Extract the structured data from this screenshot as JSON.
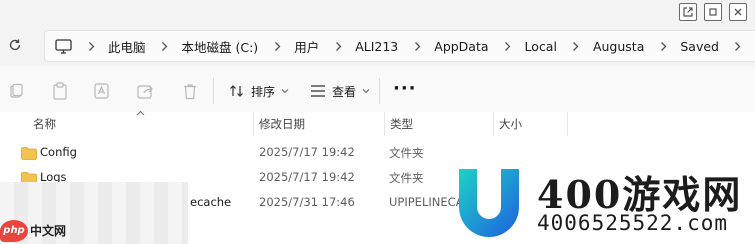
{
  "address": {
    "breadcrumbs": [
      "此电脑",
      "本地磁盘 (C:)",
      "用户",
      "ALI213",
      "AppData",
      "Local",
      "Augusta",
      "Saved"
    ]
  },
  "toolbar": {
    "sort_label": "排序",
    "view_label": "查看",
    "more_label": "···"
  },
  "columns": {
    "name": "名称",
    "modified": "修改日期",
    "type": "类型",
    "size": "大小"
  },
  "files": [
    {
      "name": "Config",
      "modified": "2025/7/17 19:42",
      "type": "文件夹"
    },
    {
      "name": "Logs",
      "modified": "2025/7/17 19:42",
      "type": "文件夹"
    },
    {
      "name": "ecache",
      "modified": "2025/7/31 17:46",
      "type": "UPIPELINECA"
    }
  ],
  "overlays": {
    "php_logo_text": "中文网",
    "php_badge_text": "php",
    "watermark_name": "400游戏网",
    "watermark_phone": "4006525522.com"
  },
  "colors": {
    "folder": "#f4c24d",
    "watermark_blue": "#1f7fe0",
    "watermark_cyan": "#1dd3c6"
  }
}
